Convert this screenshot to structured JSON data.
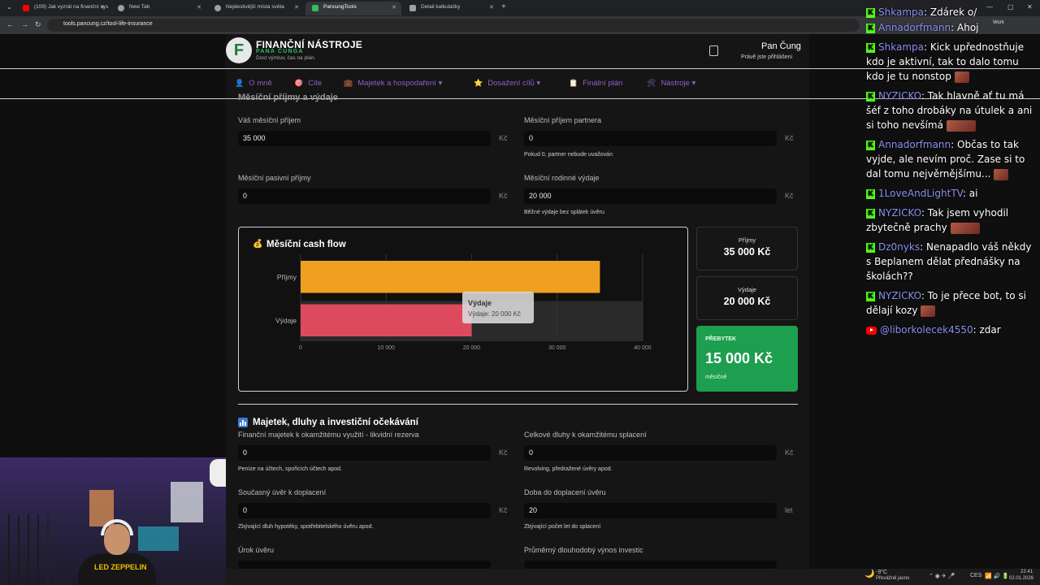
{
  "browser": {
    "tabs": [
      {
        "title": "(109) Jak vyzrát na finanční sys",
        "favicon_color": "#ff0000",
        "active": false
      },
      {
        "title": "New Tab",
        "favicon_color": "#9aa0a6",
        "active": false
      },
      {
        "title": "Nejdestivější místa světa",
        "favicon_color": "#9aa0a6",
        "active": false
      },
      {
        "title": "PancungTools",
        "favicon_color": "#2fbf5f",
        "active": true
      },
      {
        "title": "Detail kalkulačky",
        "favicon_color": "#9aa0a6",
        "active": false
      }
    ],
    "url": "tools.pancung.cz/tool-life-insurance",
    "profile_label": "Work"
  },
  "site": {
    "logo_letter": "F",
    "title": "FINANČNÍ NÁSTROJE",
    "subtitle": "PANA ČUNGA",
    "tagline": "Dost výmluv, čas na plán.",
    "user_name": "Pan Čung",
    "user_status": "Právě jste přihlášeni",
    "menu": [
      {
        "icon": "👤",
        "label": "O mně",
        "chevron": ""
      },
      {
        "icon": "🎯",
        "label": "Cíle",
        "chevron": ""
      },
      {
        "icon": "💼",
        "label": "Majetek a hospodaření",
        "chevron": "▾"
      },
      {
        "icon": "⭐",
        "label": "Dosažení cílů",
        "chevron": "▾"
      },
      {
        "icon": "📋",
        "label": "Finální plán",
        "chevron": ""
      },
      {
        "icon": "🛠",
        "label": "Nástroje",
        "chevron": "▾"
      }
    ]
  },
  "income": {
    "section_title": "Měsíční příjmy a výdaje",
    "unit": "Kč",
    "fields": {
      "my_income": {
        "label": "Váš měsíční příjem",
        "value": "35 000"
      },
      "partner_income": {
        "label": "Měsíční příjem partnera",
        "value": "0",
        "help": "Pokud 0, partner nebude uvažován"
      },
      "passive_income": {
        "label": "Měsíční pasivní příjmy",
        "value": "0"
      },
      "family_expenses": {
        "label": "Měsíční rodinné výdaje",
        "value": "20 000",
        "help": "Běžné výdaje bez splátek úvěru"
      }
    }
  },
  "cashflow": {
    "title": "Měsíční cash flow",
    "tooltip_title": "Výdaje",
    "tooltip_text": "Výdaje: 20 000 Kč",
    "cards": [
      {
        "label": "Příjmy",
        "value": "35 000 Kč"
      },
      {
        "label": "Výdaje",
        "value": "20 000 Kč"
      }
    ],
    "surplus": {
      "label": "PŘEBYTEK",
      "value": "15 000 Kč",
      "sub": "měsíčně"
    }
  },
  "chart_data": {
    "type": "bar",
    "orientation": "horizontal",
    "categories": [
      "Příjmy",
      "Výdaje"
    ],
    "values": [
      35000,
      20000
    ],
    "colors": [
      "#f0a020",
      "#dd4a5e"
    ],
    "xlim": [
      0,
      40000
    ],
    "xticks": [
      0,
      10000,
      20000,
      30000,
      40000
    ],
    "xtick_labels": [
      "0",
      "10 000",
      "20 000",
      "30 000",
      "40 000"
    ],
    "grid": true,
    "highlighted": "Výdaje"
  },
  "assets": {
    "section_title": "Majetek, dluhy a investiční očekávání",
    "unit": "Kč",
    "years_unit": "let",
    "fields": {
      "liquid_assets": {
        "label": "Finanční majetek k okamžitému využití - likvidní rezerva",
        "value": "0",
        "help": "Peníze na účtech, spořicích účtech apod."
      },
      "total_debts": {
        "label": "Celkové dluhy k okamžitému splacení",
        "value": "0",
        "help": "Revolving, předražené úvěry apod."
      },
      "current_loan": {
        "label": "Současný úvěr k doplacení",
        "value": "0",
        "help": "Zbývající dluh hypotéky, spotřebitelského úvěru apod."
      },
      "loan_term": {
        "label": "Doba do doplacení úvěru",
        "value": "20",
        "help": "Zbývající počet let do splacení"
      },
      "loan_rate": {
        "label": "Úrok úvěru"
      },
      "avg_return": {
        "label": "Průměrný dlouhodobý výnos investic"
      }
    }
  },
  "chat": [
    {
      "platform": "kick",
      "user": "Shkampa",
      "text": "Zdárek o/",
      "emote": ""
    },
    {
      "platform": "kick",
      "user": "Annadorfmann",
      "text": "Ahoj",
      "emote": ""
    },
    {
      "platform": "kick",
      "user": "Shkampa",
      "text": "Kick upřednostňuje kdo je aktivní, tak to dalo tomu kdo je tu nonstop",
      "emote": "small"
    },
    {
      "platform": "kick",
      "user": "NYZICKO",
      "text": "Tak hlavně ať tu má šéf z toho drobáky na útulek a ani si toho nevšímá",
      "emote": "wide"
    },
    {
      "platform": "kick",
      "user": "Annadorfmann",
      "text": "Občas to tak vyjde, ale nevím proč. Zase si to dal tomu nejvěrnějšímu...",
      "emote": "small"
    },
    {
      "platform": "kick",
      "user": "1LoveAndLightTV",
      "text": "ai",
      "emote": ""
    },
    {
      "platform": "kick",
      "user": "NYZICKO",
      "text": "Tak jsem vyhodil zbytečně prachy",
      "emote": "wide"
    },
    {
      "platform": "kick",
      "user": "Dz0nyks",
      "text": "Nenapadlo váš někdy s Beplanem dělat přednášky na školách??",
      "emote": ""
    },
    {
      "platform": "kick",
      "user": "NYZICKO",
      "text": "To je přece bot, to si dělají kozy",
      "emote": "small"
    },
    {
      "platform": "youtube",
      "user": "@liborkolecek4550",
      "text": "zdar",
      "emote": ""
    }
  ],
  "taskbar": {
    "weather_temp": "-9°C",
    "weather_text": "Převážně jasno",
    "lang": "CES",
    "time": "22:41",
    "date": "02.01.2026"
  },
  "webcam": {
    "shirt_text": "LED ZEPPELIN"
  }
}
